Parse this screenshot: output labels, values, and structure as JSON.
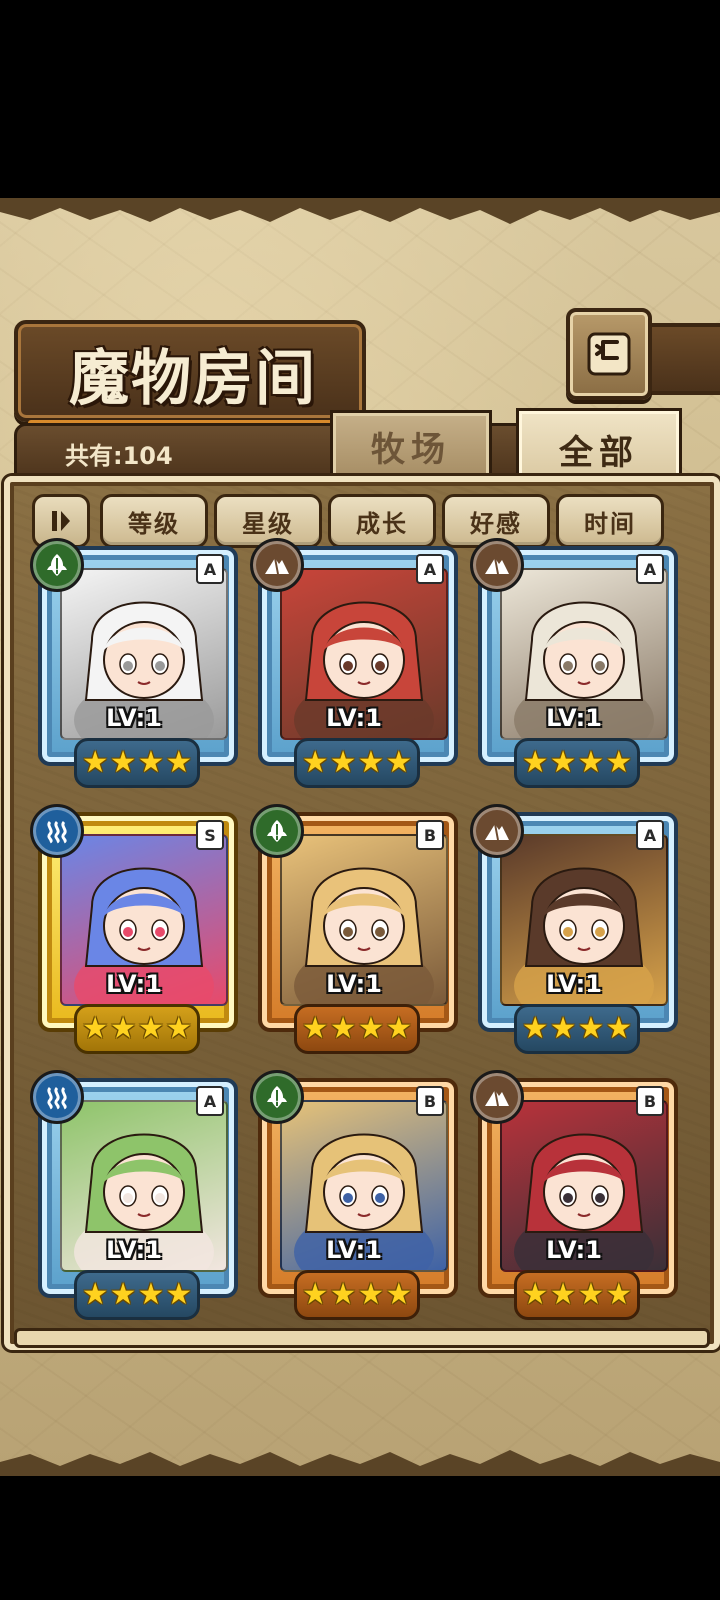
{
  "header": {
    "title": "魔物房间",
    "back_icon": "back-arrow-icon"
  },
  "summary": {
    "count_label": "共有:104"
  },
  "tabs": [
    {
      "label": "牧场",
      "active": false
    },
    {
      "label": "全部",
      "active": true
    }
  ],
  "filters": {
    "toggle_icon": "sort-order-icon",
    "buttons": [
      {
        "label": "等级"
      },
      {
        "label": "星级"
      },
      {
        "label": "成长"
      },
      {
        "label": "好感"
      },
      {
        "label": "时间"
      }
    ]
  },
  "monsters": [
    {
      "level": "LV:1",
      "rank": "A",
      "element": "nature-leaf-icon",
      "frame": "blue",
      "stars": 4,
      "palette": [
        "#f4f4f4",
        "#9a9a9a"
      ]
    },
    {
      "level": "LV:1",
      "rank": "A",
      "element": "earth-mountain-icon",
      "frame": "blue",
      "stars": 4,
      "palette": [
        "#c8453a",
        "#6a3a2a"
      ]
    },
    {
      "level": "LV:1",
      "rank": "A",
      "element": "earth-mountain-icon",
      "frame": "blue",
      "stars": 4,
      "palette": [
        "#ece6d8",
        "#8a7a68"
      ]
    },
    {
      "level": "LV:1",
      "rank": "S",
      "element": "water-wave-icon",
      "frame": "gold",
      "stars": 4,
      "palette": [
        "#6a86e6",
        "#e84a6a"
      ]
    },
    {
      "level": "LV:1",
      "rank": "B",
      "element": "nature-leaf-icon",
      "frame": "bronze",
      "stars": 4,
      "palette": [
        "#e9c27a",
        "#7a5a3a"
      ]
    },
    {
      "level": "LV:1",
      "rank": "A",
      "element": "earth-mountain-icon",
      "frame": "blue",
      "stars": 4,
      "palette": [
        "#5a3a2a",
        "#d7a24a"
      ]
    },
    {
      "level": "LV:1",
      "rank": "A",
      "element": "water-wave-icon",
      "frame": "blue",
      "stars": 4,
      "palette": [
        "#8ec46a",
        "#f2e6e0"
      ]
    },
    {
      "level": "LV:1",
      "rank": "B",
      "element": "nature-leaf-icon",
      "frame": "bronze",
      "stars": 4,
      "palette": [
        "#e6c278",
        "#3e62a6"
      ]
    },
    {
      "level": "LV:1",
      "rank": "B",
      "element": "earth-mountain-icon",
      "frame": "bronze",
      "stars": 4,
      "palette": [
        "#b8323a",
        "#3a3038"
      ]
    }
  ]
}
